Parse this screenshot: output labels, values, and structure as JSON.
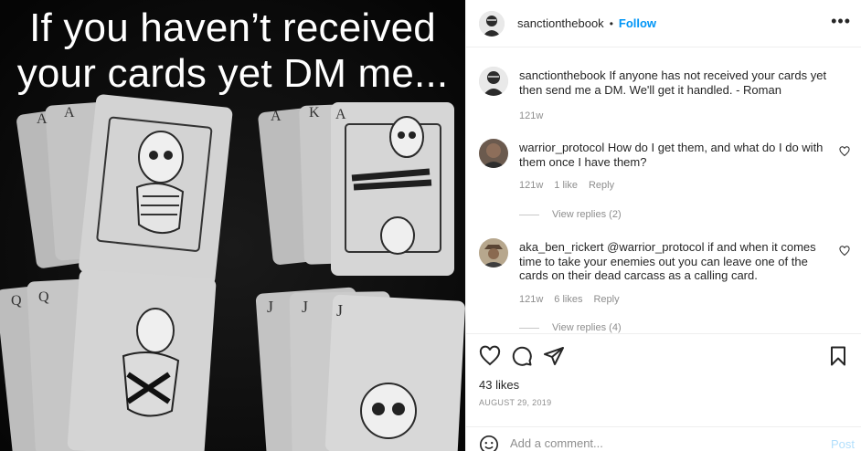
{
  "media": {
    "overlay_line1": "If you haven’t received",
    "overlay_line2": "your cards yet DM me..."
  },
  "header": {
    "username": "sanctionthebook",
    "separator": "•",
    "follow_label": "Follow",
    "more_label": "•••"
  },
  "caption": {
    "username": "sanctionthebook",
    "text": "If anyone has not received your cards yet then send me a DM. We'll get it handled. - Roman",
    "age": "121w"
  },
  "comments": [
    {
      "username": "warrior_protocol",
      "text": "How do I get them, and what do I do with them once I have them?",
      "age": "121w",
      "likes": "1 like",
      "reply_label": "Reply",
      "view_replies": "View replies (2)"
    },
    {
      "username": "aka_ben_rickert",
      "text": "@warrior_protocol if and when it comes time to take your enemies out you can leave one of the cards on their dead carcass as a calling card.",
      "age": "121w",
      "likes": "6 likes",
      "reply_label": "Reply",
      "view_replies": "View replies (4)"
    }
  ],
  "footer": {
    "likes": "43 likes",
    "date": "AUGUST 29, 2019",
    "comment_placeholder": "Add a comment...",
    "post_label": "Post"
  },
  "icons": {
    "like": "heart-icon",
    "comment": "comment-icon",
    "share": "paper-plane-icon",
    "save": "bookmark-icon",
    "emoji": "smiley-icon",
    "more": "more-dots-icon"
  },
  "colors": {
    "follow": "#0095f6",
    "muted": "#8e8e8e",
    "text": "#262626",
    "post_disabled": "#b2dffc"
  }
}
